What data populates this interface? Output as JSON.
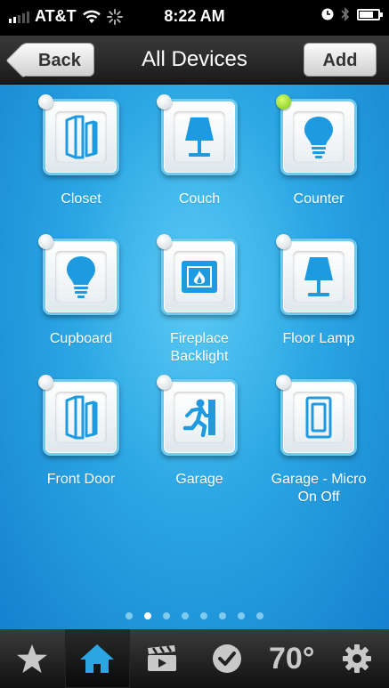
{
  "status_bar": {
    "carrier": "AT&T",
    "time": "8:22 AM"
  },
  "nav": {
    "back_label": "Back",
    "title": "All Devices",
    "add_label": "Add"
  },
  "devices": [
    {
      "label": "Closet",
      "icon": "door-sensor-icon",
      "on": false
    },
    {
      "label": "Couch",
      "icon": "lamp-icon",
      "on": false
    },
    {
      "label": "Counter",
      "icon": "light-bulb-icon",
      "on": true
    },
    {
      "label": "Cupboard",
      "icon": "light-bulb-icon",
      "on": false
    },
    {
      "label": "Fireplace Backlight",
      "icon": "fireplace-icon",
      "on": false
    },
    {
      "label": "Floor Lamp",
      "icon": "lamp-icon",
      "on": false
    },
    {
      "label": "Front Door",
      "icon": "door-sensor-icon",
      "on": false
    },
    {
      "label": "Garage",
      "icon": "exit-runner-icon",
      "on": false
    },
    {
      "label": "Garage - Micro On Off",
      "icon": "wall-switch-icon",
      "on": false
    }
  ],
  "page_indicator": {
    "count": 8,
    "active_index": 1
  },
  "tabs": [
    {
      "name": "favorites",
      "icon": "star-icon"
    },
    {
      "name": "home",
      "icon": "home-icon",
      "selected": true
    },
    {
      "name": "scenes",
      "icon": "clapperboard-icon"
    },
    {
      "name": "tasks",
      "icon": "checkmark-icon"
    },
    {
      "name": "thermostat",
      "text": "70°"
    },
    {
      "name": "settings",
      "icon": "gear-icon"
    }
  ],
  "colors": {
    "accent_blue": "#2ba6e3",
    "icon_blue": "#1e9be0",
    "on_indicator": "#8fd12a"
  }
}
